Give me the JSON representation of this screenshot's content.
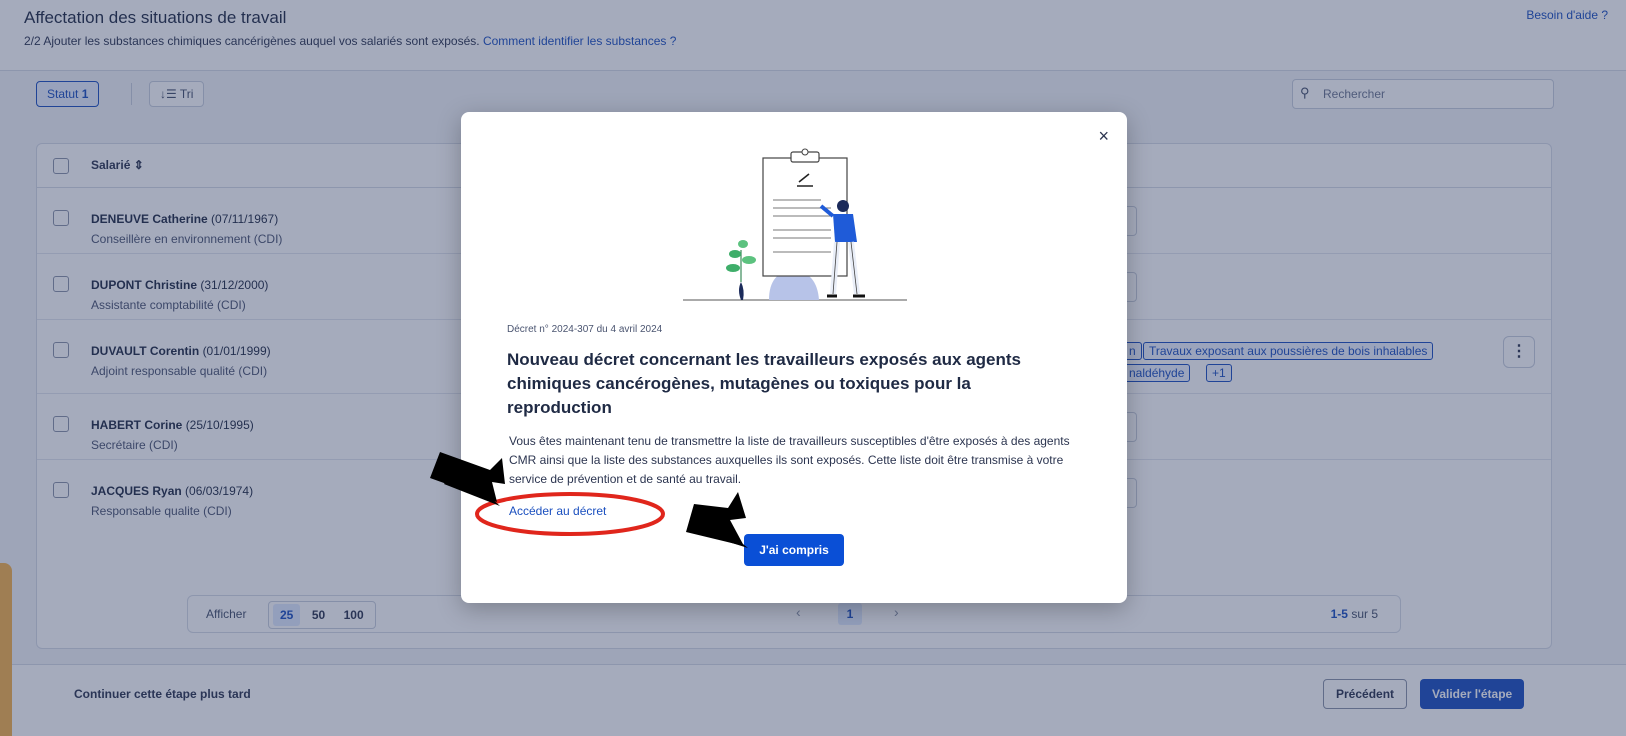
{
  "header": {
    "title": "Affectation des situations de travail",
    "subtitle": "2/2 Ajouter les substances chimiques cancérigènes auquel vos salariés sont exposés.",
    "subtitle_link": "Comment identifier les substances ?",
    "help": "Besoin d'aide ?"
  },
  "toolbar": {
    "statut_label": "Statut",
    "statut_count": "1",
    "tri_label": "Tri",
    "search_placeholder": "Rechercher"
  },
  "table": {
    "column_header": "Salarié",
    "rows": [
      {
        "name": "DENEUVE Catherine",
        "birth": "(07/11/1967)",
        "role": "Conseillère en environnement (CDI)"
      },
      {
        "name": "DUPONT Christine",
        "birth": "(31/12/2000)",
        "role": "Assistante comptabilité (CDI)"
      },
      {
        "name": "DUVAULT Corentin",
        "birth": "(01/01/1999)",
        "role": "Adjoint responsable qualité (CDI)"
      },
      {
        "name": "HABERT Corine",
        "birth": "(25/10/1995)",
        "role": "Secrétaire (CDI)"
      },
      {
        "name": "JACQUES Ryan",
        "birth": "(06/03/1974)",
        "role": "Responsable qualite (CDI)"
      }
    ],
    "tags_row3": {
      "tag_a": "n",
      "tag_b": "Travaux exposant aux poussières de bois inhalables",
      "tag_c": "naldéhyde",
      "tag_more": "+1"
    }
  },
  "pagination": {
    "show_label": "Afficher",
    "sizes": [
      "25",
      "50",
      "100"
    ],
    "current_page": "1",
    "range": "1-5",
    "total_label": "sur 5"
  },
  "footer": {
    "later": "Continuer cette étape plus tard",
    "previous": "Précédent",
    "validate": "Valider l'étape"
  },
  "modal": {
    "decree_ref": "Décret n° 2024-307 du 4 avril 2024",
    "title": "Nouveau décret concernant les travailleurs exposés aux agents chimiques cancérogènes, mutagènes ou toxiques pour la reproduction",
    "body": "Vous êtes maintenant tenu de transmettre la liste de travailleurs susceptibles d'être exposés à des agents CMR ainsi que la liste des substances auxquelles ils sont exposés. Cette liste doit être transmise à votre service de prévention et de santé au travail.",
    "link": "Accéder au décret",
    "ok": "J'ai compris",
    "close": "×"
  },
  "colors": {
    "primary": "#1a4fbf",
    "button": "#0a4fd6",
    "annotation_red": "#e0261c",
    "accent_orange": "#f5b24a"
  }
}
